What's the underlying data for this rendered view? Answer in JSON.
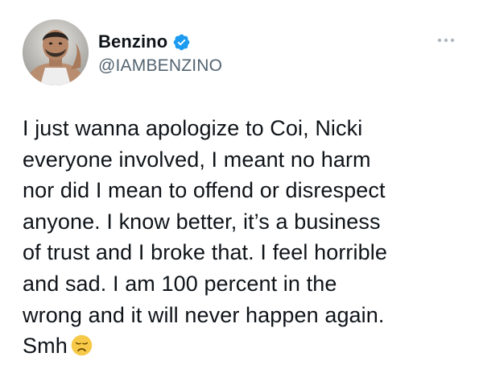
{
  "tweet": {
    "author": {
      "display_name": "Benzino",
      "handle": "@IAMBENZINO",
      "verified": true,
      "verified_badge_color": "#1d9bf0",
      "avatar_icon": "profile-photo"
    },
    "more_icon": "more-horizontal-icon",
    "text_lines": [
      "I just wanna apologize to Coi, Nicki",
      "everyone involved, I meant no harm",
      "nor did I mean to offend or disrespect",
      "anyone. I know better, it’s a business",
      "of trust and I broke that. I feel horrible",
      "and sad. I am 100 percent in the",
      "wrong and it will never happen again.",
      "Smh"
    ],
    "emoji": "disappointed-face-emoji",
    "colors": {
      "text": "#0f1419",
      "secondary": "#536471",
      "accent": "#1d9bf0",
      "emoji_face": "#f7c948"
    }
  }
}
